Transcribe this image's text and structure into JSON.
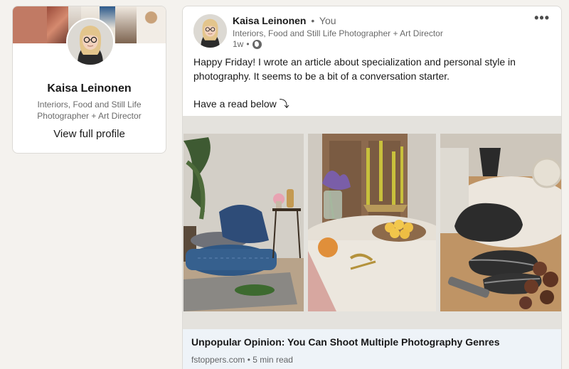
{
  "profile": {
    "name": "Kaisa Leinonen",
    "headline": "Interiors, Food and Still Life Photographer + Art Director",
    "view_profile_label": "View full profile"
  },
  "post": {
    "author_name": "Kaisa Leinonen",
    "relation_sep": "•",
    "relation": "You",
    "author_headline": "Interiors, Food and Still Life Photographer + Art Director",
    "time_ago": "1w",
    "meta_sep": "•",
    "visibility_icon": "globe-icon",
    "more_label": "•••",
    "text_para1": "Happy Friday! I wrote an article about specialization and personal style in photography. It seems to be a bit of a conversation starter.",
    "text_para2": "Have a read below ⤵︎",
    "link_title": "Unpopular Opinion: You Can Shoot Multiple Photography Genres",
    "link_source": "fstoppers.com",
    "link_sep": "•",
    "link_read_time": "5 min read"
  },
  "colors": {
    "page_bg": "#f4f2ee",
    "card_bg": "#ffffff",
    "link_footer_bg": "#eef3f8",
    "text_primary": "rgba(0,0,0,0.9)",
    "text_secondary": "rgba(0,0,0,0.6)"
  }
}
